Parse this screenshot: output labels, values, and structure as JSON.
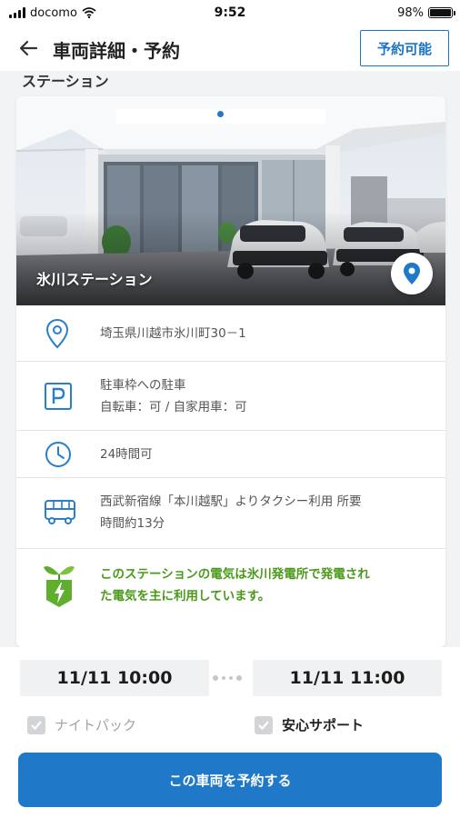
{
  "status": {
    "carrier": "docomo",
    "time": "9:52",
    "battery": "98%",
    "battery_level": 0.98
  },
  "header": {
    "title": "車両詳細・予約",
    "availability": "予約可能"
  },
  "section": {
    "label": "ステーション"
  },
  "station": {
    "name": "氷川ステーション",
    "carousel_pages": 2,
    "carousel_active": 1
  },
  "info": {
    "address": "埼玉県川越市氷川町30－1",
    "parking_title": "駐車枠への駐車",
    "parking_detail": "自転車：可 / 自家用車：可",
    "hours": "24時間可",
    "access_line1": "西武新宿線「本川越駅」よりタクシー利用 所要",
    "access_line2": "時間約13分",
    "eco_line1": "このステーションの電気は氷川発電所で発電され",
    "eco_line2": "た電気を主に利用しています。"
  },
  "booking": {
    "start": "11/11 10:00",
    "end": "11/11 11:00",
    "option_night": "ナイトパック",
    "option_support": "安心サポート",
    "reserve_label": "この車両を予約する"
  },
  "colors": {
    "accent": "#1f78c8",
    "icon_blue": "#2b7ec9",
    "eco_green": "#4a9a1a"
  },
  "icons": {
    "back": "arrow-left-icon",
    "map": "map-pin-icon",
    "address": "location-pin-icon",
    "parking": "parking-icon",
    "hours": "clock-icon",
    "access": "bus-icon",
    "eco": "eco-energy-icon"
  }
}
